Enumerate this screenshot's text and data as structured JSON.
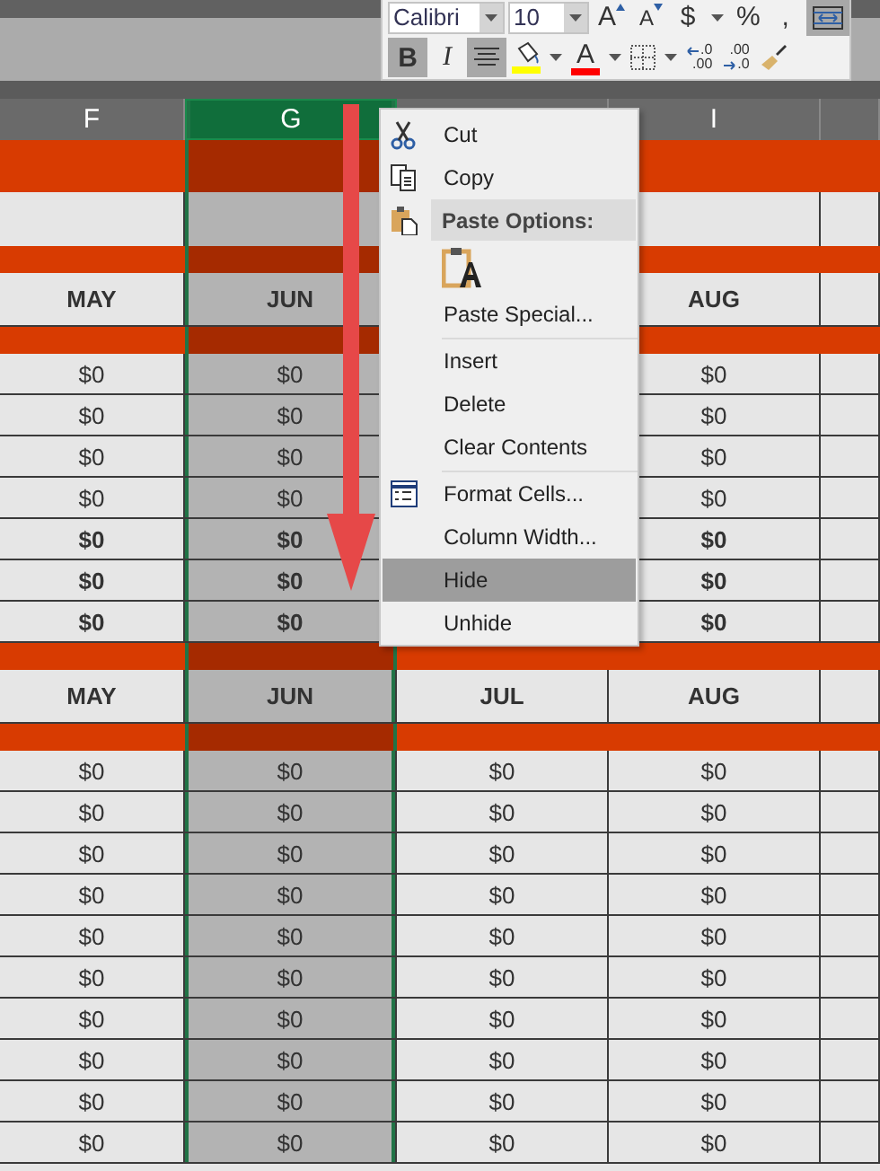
{
  "toolbar": {
    "font_name": "Calibri",
    "font_size": "10",
    "row_1": [
      {
        "kind": "grow",
        "label": "A",
        "on": false
      },
      {
        "kind": "shrink",
        "label": "A",
        "on": false
      },
      {
        "kind": "text",
        "label": "$",
        "on": false
      },
      {
        "kind": "caret",
        "on": false
      },
      {
        "kind": "text",
        "label": "%",
        "on": false
      },
      {
        "kind": "text",
        "label": ",",
        "on": false
      },
      {
        "kind": "wrap",
        "on": true
      }
    ],
    "row_2": [
      {
        "kind": "bold",
        "label": "B",
        "on": true
      },
      {
        "kind": "italic",
        "label": "I",
        "on": false
      },
      {
        "kind": "align",
        "on": true
      },
      {
        "kind": "fill",
        "color": "#ffff00",
        "on": false
      },
      {
        "kind": "caret",
        "on": false
      },
      {
        "kind": "fontcolor",
        "label": "A",
        "color": "#ff0000",
        "on": false
      },
      {
        "kind": "caret",
        "on": false
      },
      {
        "kind": "borders",
        "on": false
      },
      {
        "kind": "caret",
        "on": false
      },
      {
        "kind": "incdec",
        "lines": [
          ".0",
          ".00"
        ],
        "on": false
      },
      {
        "kind": "decdec",
        "lines": [
          ".00",
          ".0"
        ],
        "on": false
      },
      {
        "kind": "painter",
        "on": false
      }
    ]
  },
  "sheet": {
    "columns": [
      {
        "letter": "F",
        "selected": false
      },
      {
        "letter": "G",
        "selected": true
      },
      {
        "selected": false
      },
      {
        "letter": "I",
        "selected": false
      },
      {
        "selected": false
      }
    ],
    "rows": [
      {
        "kind": "band"
      },
      {
        "kind": "blank"
      },
      {
        "kind": "band"
      },
      {
        "kind": "header",
        "cells": [
          "MAY",
          "JUN",
          null,
          "AUG",
          null
        ]
      },
      {
        "kind": "band"
      },
      {
        "kind": "data",
        "bold": false,
        "cells": [
          "$0",
          "$0",
          null,
          "$0",
          null
        ]
      },
      {
        "kind": "data",
        "bold": false,
        "cells": [
          "$0",
          "$0",
          null,
          "$0",
          null
        ]
      },
      {
        "kind": "data",
        "bold": false,
        "cells": [
          "$0",
          "$0",
          null,
          "$0",
          null
        ]
      },
      {
        "kind": "data",
        "bold": false,
        "cells": [
          "$0",
          "$0",
          null,
          "$0",
          null
        ]
      },
      {
        "kind": "data",
        "bold": true,
        "cells": [
          "$0",
          "$0",
          null,
          "$0",
          null
        ]
      },
      {
        "kind": "data",
        "bold": true,
        "cells": [
          "$0",
          "$0",
          null,
          "$0",
          null
        ]
      },
      {
        "kind": "data",
        "bold": true,
        "cells": [
          "$0",
          "$0",
          null,
          "$0",
          null
        ]
      },
      {
        "kind": "band"
      },
      {
        "kind": "header",
        "cells": [
          "MAY",
          "JUN",
          "JUL",
          "AUG",
          null
        ]
      },
      {
        "kind": "band"
      },
      {
        "kind": "data",
        "bold": false,
        "cells": [
          "$0",
          "$0",
          "$0",
          "$0",
          null
        ]
      },
      {
        "kind": "data",
        "bold": false,
        "cells": [
          "$0",
          "$0",
          "$0",
          "$0",
          null
        ]
      },
      {
        "kind": "data",
        "bold": false,
        "cells": [
          "$0",
          "$0",
          "$0",
          "$0",
          null
        ]
      },
      {
        "kind": "data",
        "bold": false,
        "cells": [
          "$0",
          "$0",
          "$0",
          "$0",
          null
        ]
      },
      {
        "kind": "data",
        "bold": false,
        "cells": [
          "$0",
          "$0",
          "$0",
          "$0",
          null
        ]
      },
      {
        "kind": "data",
        "bold": false,
        "cells": [
          "$0",
          "$0",
          "$0",
          "$0",
          null
        ]
      },
      {
        "kind": "data",
        "bold": false,
        "cells": [
          "$0",
          "$0",
          "$0",
          "$0",
          null
        ]
      },
      {
        "kind": "data",
        "bold": false,
        "cells": [
          "$0",
          "$0",
          "$0",
          "$0",
          null
        ]
      },
      {
        "kind": "data",
        "bold": false,
        "cells": [
          "$0",
          "$0",
          "$0",
          "$0",
          null
        ]
      },
      {
        "kind": "data",
        "bold": false,
        "cells": [
          "$0",
          "$0",
          "$0",
          "$0",
          null
        ]
      }
    ]
  },
  "context_menu": [
    {
      "kind": "item",
      "label": "Cut",
      "selected": false
    },
    {
      "kind": "item",
      "label": "Copy",
      "selected": false
    },
    {
      "kind": "header",
      "label": "Paste Options:"
    },
    {
      "kind": "paste"
    },
    {
      "kind": "item",
      "label": "Paste Special...",
      "selected": false
    },
    {
      "kind": "separator"
    },
    {
      "kind": "item",
      "label": "Insert",
      "selected": false
    },
    {
      "kind": "item",
      "label": "Delete",
      "selected": false
    },
    {
      "kind": "item",
      "label": "Clear Contents",
      "selected": false
    },
    {
      "kind": "separator"
    },
    {
      "kind": "item",
      "label": "Format Cells...",
      "selected": false
    },
    {
      "kind": "item",
      "label": "Column Width...",
      "selected": false
    },
    {
      "kind": "item",
      "label": "Hide",
      "selected": true
    },
    {
      "kind": "item",
      "label": "Unhide",
      "selected": false
    }
  ]
}
